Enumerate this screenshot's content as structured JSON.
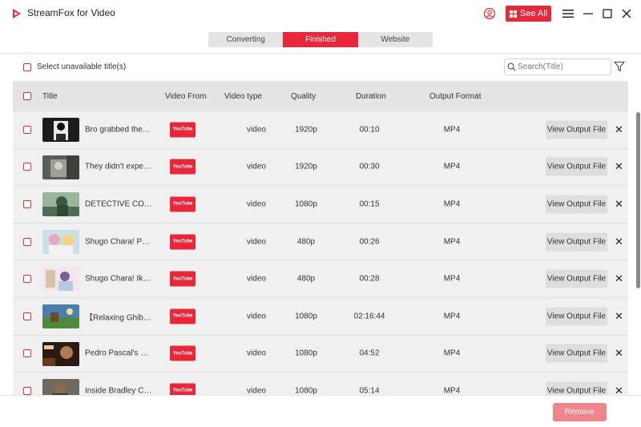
{
  "app": {
    "title": "StreamFox for Video"
  },
  "header": {
    "see_all_label": "See All"
  },
  "tabs": [
    {
      "label": "Converting",
      "active": false
    },
    {
      "label": "Finished",
      "active": true
    },
    {
      "label": "Website",
      "active": false
    }
  ],
  "toolbar": {
    "select_unavailable_label": "Select unavailable title(s)",
    "search_placeholder": "Search(Title)"
  },
  "table": {
    "columns": [
      "Title",
      "Video From",
      "Video type",
      "Quality",
      "Duration",
      "Output Format"
    ],
    "rows": [
      {
        "title": "Bro grabbed the wrong...",
        "source": "YouTube",
        "type": "video",
        "quality": "1920p",
        "duration": "00:10",
        "format": "MP4",
        "action": "View Output File"
      },
      {
        "title": "They didn't expect...",
        "source": "YouTube",
        "type": "video",
        "quality": "1920p",
        "duration": "00:30",
        "format": "MP4",
        "action": "View Output File"
      },
      {
        "title": "DETECTIVE CONAN...",
        "source": "YouTube",
        "type": "video",
        "quality": "1080p",
        "duration": "00:15",
        "format": "MP4",
        "action": "View Output File"
      },
      {
        "title": "Shugo Chara! Party...",
        "source": "YouTube",
        "type": "video",
        "quality": "480p",
        "duration": "00:26",
        "format": "MP4",
        "action": "View Output File"
      },
      {
        "title": "Shugo Chara! Ikuto...",
        "source": "YouTube",
        "type": "video",
        "quality": "480p",
        "duration": "00:28",
        "format": "MP4",
        "action": "View Output File"
      },
      {
        "title": "【Relaxing Ghibli...",
        "source": "YouTube",
        "type": "video",
        "quality": "1080p",
        "duration": "02:16:44",
        "format": "MP4",
        "action": "View Output File"
      },
      {
        "title": "Pedro Pascal's Best...",
        "source": "YouTube",
        "type": "video",
        "quality": "1080p",
        "duration": "04:52",
        "format": "MP4",
        "action": "View Output File"
      },
      {
        "title": "Inside Bradley Cooper...",
        "source": "YouTube",
        "type": "video",
        "quality": "1080p",
        "duration": "05:14",
        "format": "MP4",
        "action": "View Output File"
      }
    ]
  },
  "footer": {
    "remove_label": "Remove"
  },
  "colors": {
    "accent": "#e8283a",
    "remove_disabled": "#f0848e",
    "row_bg": "#f0f0f0",
    "header_bg": "#e4e4e4"
  }
}
